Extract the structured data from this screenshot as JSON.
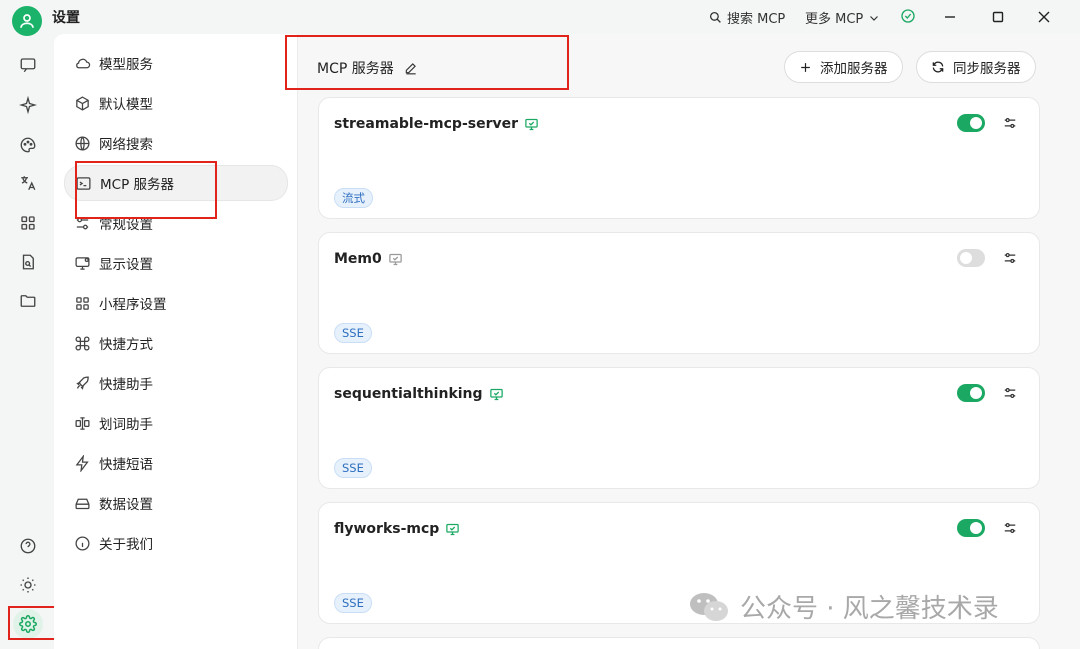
{
  "titlebar": {
    "app_title": "设置",
    "search_mcp": "搜索 MCP",
    "more_mcp": "更多 MCP"
  },
  "menu": {
    "items": [
      {
        "label": "模型服务",
        "icon": "cloud-icon"
      },
      {
        "label": "默认模型",
        "icon": "cube-icon"
      },
      {
        "label": "网络搜索",
        "icon": "globe-icon"
      },
      {
        "label": "MCP 服务器",
        "icon": "terminal-icon"
      },
      {
        "label": "常规设置",
        "icon": "sliders-icon"
      },
      {
        "label": "显示设置",
        "icon": "monitor-icon"
      },
      {
        "label": "小程序设置",
        "icon": "grid-icon"
      },
      {
        "label": "快捷方式",
        "icon": "command-icon"
      },
      {
        "label": "快捷助手",
        "icon": "rocket-icon"
      },
      {
        "label": "划词助手",
        "icon": "text-cursor-icon"
      },
      {
        "label": "快捷短语",
        "icon": "zap-icon"
      },
      {
        "label": "数据设置",
        "icon": "hard-drive-icon"
      },
      {
        "label": "关于我们",
        "icon": "info-icon"
      }
    ],
    "active_index": 3
  },
  "main": {
    "title": "MCP 服务器",
    "add_server": "添加服务器",
    "sync_server": "同步服务器",
    "servers": [
      {
        "name": "streamable-mcp-server",
        "enabled": true,
        "tag": "流式"
      },
      {
        "name": "Mem0",
        "enabled": false,
        "tag": "SSE"
      },
      {
        "name": "sequentialthinking",
        "enabled": true,
        "tag": "SSE"
      },
      {
        "name": "flyworks-mcp",
        "enabled": true,
        "tag": "SSE"
      }
    ]
  },
  "watermark": "公众号 · 风之馨技术录",
  "colors": {
    "accent": "#1aa862",
    "highlight_box": "#e0231b",
    "tag_text": "#2f6fc0",
    "tag_bg": "#e7f1fc"
  }
}
